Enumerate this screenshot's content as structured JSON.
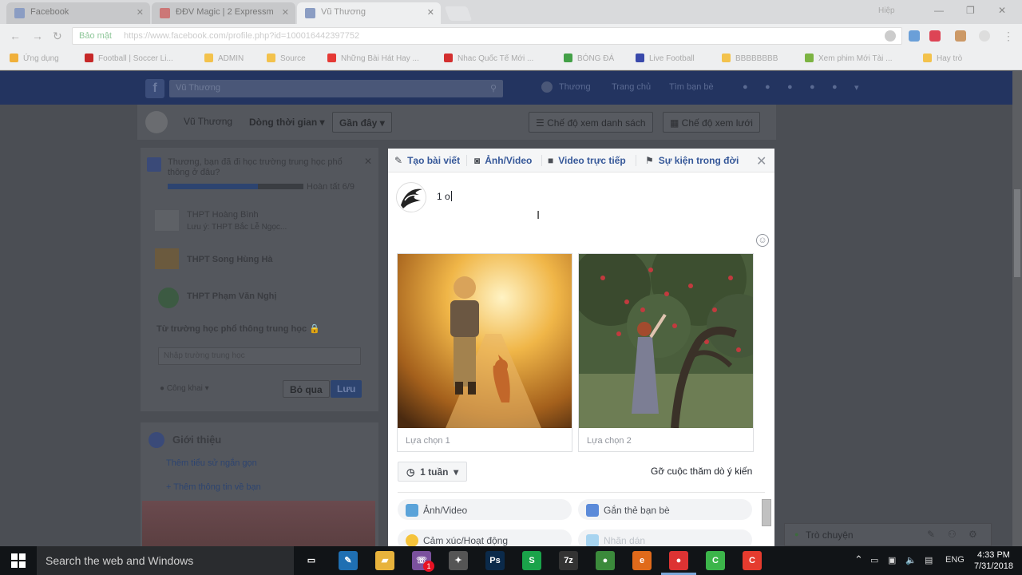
{
  "browser": {
    "tabs": [
      {
        "label": "Facebook"
      },
      {
        "label": "ĐĐV Magic | 2 Expressm"
      },
      {
        "label": "Vũ Thương"
      }
    ],
    "profile_label": "Hiệp",
    "address": {
      "secure_label": "Bảo mật",
      "url": "https://www.facebook.com/profile.php?id=100016442397752"
    },
    "bookmarks": [
      {
        "label": "Ứng dụng",
        "color": "#f0b03b"
      },
      {
        "label": "Football | Soccer Li...",
        "color": "#c62828"
      },
      {
        "label": "ADMIN",
        "color": "#f3c24c"
      },
      {
        "label": "Source",
        "color": "#f3c24c"
      },
      {
        "label": "Những Bài Hát Hay ...",
        "color": "#e53935"
      },
      {
        "label": "Nhac Quốc Tế Mới ...",
        "color": "#d32f2f"
      },
      {
        "label": "BÓNG ĐÁ",
        "color": "#43a047"
      },
      {
        "label": "Live Football",
        "color": "#3949ab"
      },
      {
        "label": "BBBBBBBB",
        "color": "#f3c24c"
      },
      {
        "label": "Xem phim Mới Tài ...",
        "color": "#7cb342"
      },
      {
        "label": "Hay trò",
        "color": "#f3c24c"
      }
    ]
  },
  "facebook": {
    "search_value": "Vũ Thương",
    "nav": [
      "Thương",
      "Trang chủ",
      "Tìm bạn bè"
    ],
    "profile_name": "Vũ Thương",
    "timeline_filter": "Dòng thời gian",
    "recent_filter": "Gần đây",
    "list_view": "Chế độ xem danh sách",
    "grid_view": "Chế độ xem lưới",
    "left": {
      "prompt": "Thương, bạn đã đi học trường trung học phổ thông ở đâu?",
      "progress_text": "Hoàn tất 6/9",
      "progress": 0.667,
      "schools": [
        "THPT Hoàng Bình",
        "Lưu ý: THPT Bắc Lễ Ngọc...",
        "THPT Song Hùng Hà",
        "THPT Phạm Văn Nghị"
      ],
      "private_label": "Từ trường học phổ thông trung học",
      "input_placeholder": "Nhập trường trung học",
      "privacy": "Công khai",
      "skip": "Bỏ qua",
      "save": "Lưu"
    },
    "intro": {
      "title": "Giới thiệu",
      "link1": "Thêm tiểu sử ngắn gọn",
      "link2": "Thêm thông tin về bạn"
    },
    "chat_label": "Trò chuyện"
  },
  "modal": {
    "tabs": [
      {
        "label": "Tạo bài viết",
        "icon": "pencil-icon"
      },
      {
        "label": "Ảnh/Video",
        "icon": "camera-icon"
      },
      {
        "label": "Video trực tiếp",
        "icon": "video-camera-icon"
      },
      {
        "label": "Sự kiện trong đời",
        "icon": "flag-icon"
      }
    ],
    "post_text": "1 o",
    "choices": [
      {
        "placeholder": "Lựa chọn 1"
      },
      {
        "placeholder": "Lựa chọn 2"
      }
    ],
    "duration": "1 tuần",
    "remove_poll": "Gỡ cuộc thăm dò ý kiến",
    "options": [
      {
        "label": "Ảnh/Video",
        "icon": "photo-icon",
        "color": "#5ba3d9"
      },
      {
        "label": "Gắn thẻ bạn bè",
        "icon": "tag-friends-icon",
        "color": "#5b8ad9"
      },
      {
        "label": "Cảm xúc/Hoạt động",
        "icon": "emoji-icon",
        "color": "#f5c33b"
      },
      {
        "label": "Nhãn dán",
        "icon": "sticker-icon",
        "color": "#a8d4f0"
      }
    ]
  },
  "taskbar": {
    "search_placeholder": "Search the web and Windows",
    "apps": [
      {
        "name": "task-view",
        "label": "▭",
        "color": "#111417"
      },
      {
        "name": "app-blue",
        "label": "✎",
        "color": "#1f6fb2"
      },
      {
        "name": "file-explorer",
        "label": "▰",
        "color": "#e8b33c"
      },
      {
        "name": "viber",
        "label": "☏",
        "color": "#7b519d"
      },
      {
        "name": "app-bird",
        "label": "✦",
        "color": "#555"
      },
      {
        "name": "photoshop",
        "label": "Ps",
        "color": "#0b2a4a"
      },
      {
        "name": "app-green",
        "label": "S",
        "color": "#1aa34a"
      },
      {
        "name": "7zip",
        "label": "7z",
        "color": "#333"
      },
      {
        "name": "chrome",
        "label": "●",
        "color": "#3b8a3b"
      },
      {
        "name": "edge-app",
        "label": "e",
        "color": "#e06a1b"
      },
      {
        "name": "chrome-active",
        "label": "●",
        "color": "#d33"
      },
      {
        "name": "camtasia-green",
        "label": "C",
        "color": "#3cb54a"
      },
      {
        "name": "camtasia-red",
        "label": "C",
        "color": "#e53b2e"
      }
    ],
    "badge": "1",
    "lang": "ENG",
    "time": "4:33 PM",
    "date": "7/31/2018"
  }
}
